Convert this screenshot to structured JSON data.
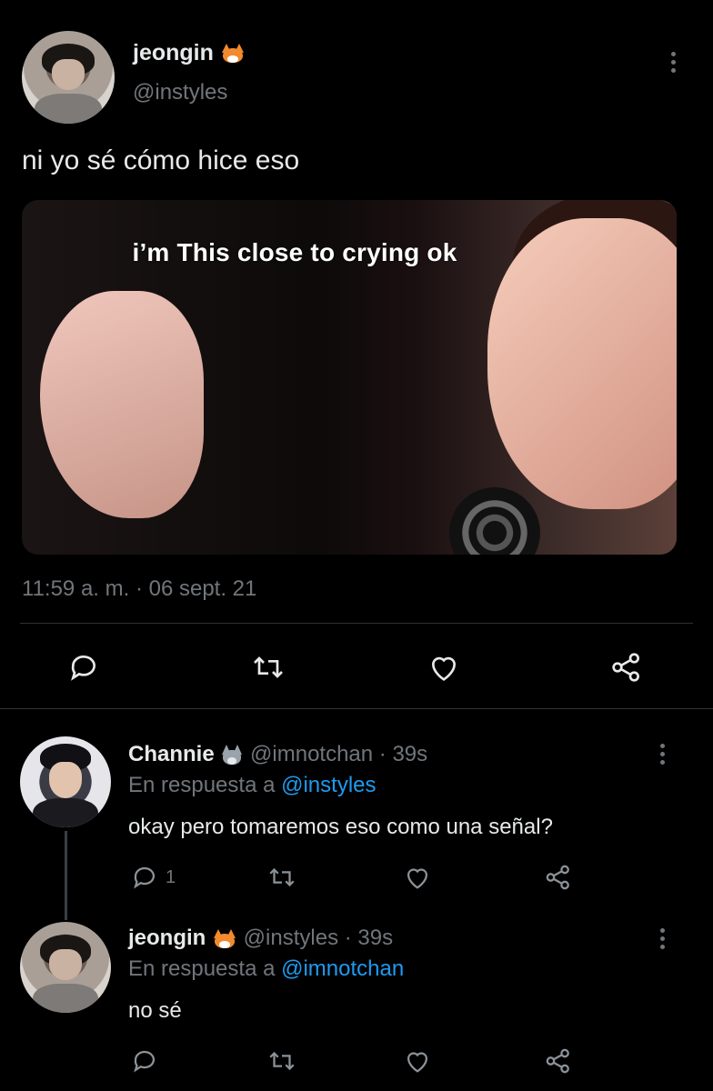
{
  "main_tweet": {
    "author": {
      "name": "jeongin",
      "handle": "@instyles",
      "emoji": "fox-face"
    },
    "text": "ni yo sé cómo hice eso",
    "media": {
      "meme_text": "i’m This close to crying ok"
    },
    "timestamp": "11:59 a. m. · 06 sept. 21",
    "actions": [
      "reply",
      "retweet",
      "like",
      "share"
    ]
  },
  "replies": [
    {
      "author": {
        "name": "Channie",
        "handle": "@imnotchan",
        "emoji": "wolf-face"
      },
      "time": "· 39s",
      "in_reply_prefix": "En respuesta a",
      "in_reply_to": "@instyles",
      "text": "okay pero tomaremos eso como una señal?",
      "reply_count": "1"
    },
    {
      "author": {
        "name": "jeongin",
        "handle": "@instyles",
        "emoji": "fox-face"
      },
      "time": "· 39s",
      "in_reply_prefix": "En respuesta a",
      "in_reply_to": "@imnotchan",
      "text": "no sé",
      "reply_count": ""
    }
  ],
  "colors": {
    "background": "#000000",
    "text": "#e7e9ea",
    "muted": "#71767b",
    "link": "#1d9bf0"
  }
}
